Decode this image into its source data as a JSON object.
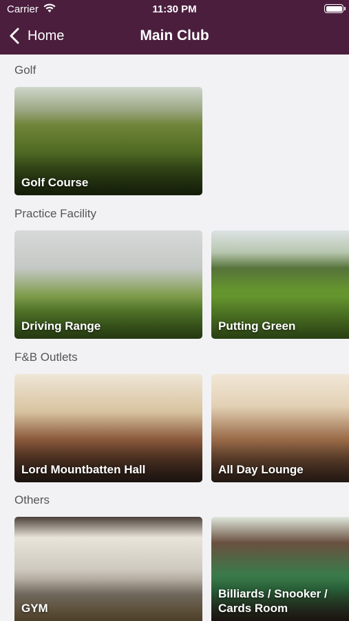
{
  "status_bar": {
    "carrier": "Carrier",
    "time": "11:30 PM"
  },
  "nav": {
    "back_label": "Home",
    "title": "Main Club"
  },
  "sections": [
    {
      "title": "Golf",
      "items": [
        {
          "label": "Golf Course"
        }
      ]
    },
    {
      "title": "Practice Facility",
      "items": [
        {
          "label": "Driving Range"
        },
        {
          "label": "Putting Green"
        }
      ]
    },
    {
      "title": "F&B Outlets",
      "items": [
        {
          "label": "Lord Mountbatten Hall"
        },
        {
          "label": "All Day Lounge"
        }
      ]
    },
    {
      "title": "Others",
      "items": [
        {
          "label": "GYM"
        },
        {
          "label": "Billiards / Snooker / Cards Room"
        }
      ]
    }
  ],
  "colors": {
    "header_bg": "#4b1e3e",
    "page_bg": "#f2f2f4",
    "section_title": "#555555"
  }
}
